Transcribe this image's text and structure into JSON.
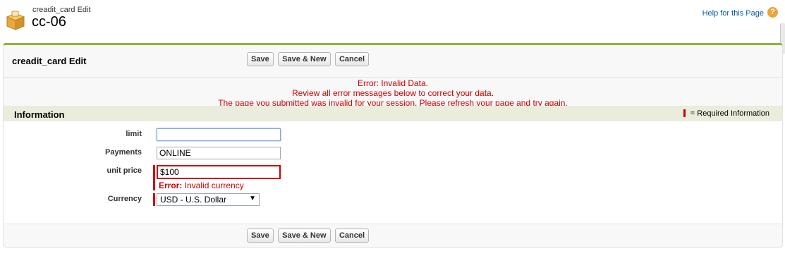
{
  "header": {
    "object_type": "creadit_card Edit",
    "record_name": "cc-06",
    "help_link": "Help for this Page",
    "help_icon": "question-circle-icon",
    "object_icon": "package-box-icon"
  },
  "block": {
    "title": "creadit_card Edit",
    "buttons": [
      "Save",
      "Save & New",
      "Cancel"
    ]
  },
  "errors": [
    "Error: Invalid Data.",
    "Review all error messages below to correct your data.",
    "The page you submitted was invalid for your session. Please refresh your page and try again."
  ],
  "section": {
    "title": "Information",
    "required_info": "= Required Information"
  },
  "fields": {
    "limit": {
      "label": "limit",
      "value": ""
    },
    "payments": {
      "label": "Payments",
      "value": "ONLINE"
    },
    "unit_price": {
      "label": "unit price",
      "value": "$100",
      "error_prefix": "Error:",
      "error_text": " Invalid currency"
    },
    "currency": {
      "label": "Currency",
      "value": "USD - U.S. Dollar"
    }
  },
  "colors": {
    "accent_green": "#8fb53a",
    "error_red": "#cc0000",
    "section_bg": "#eaecdc"
  }
}
